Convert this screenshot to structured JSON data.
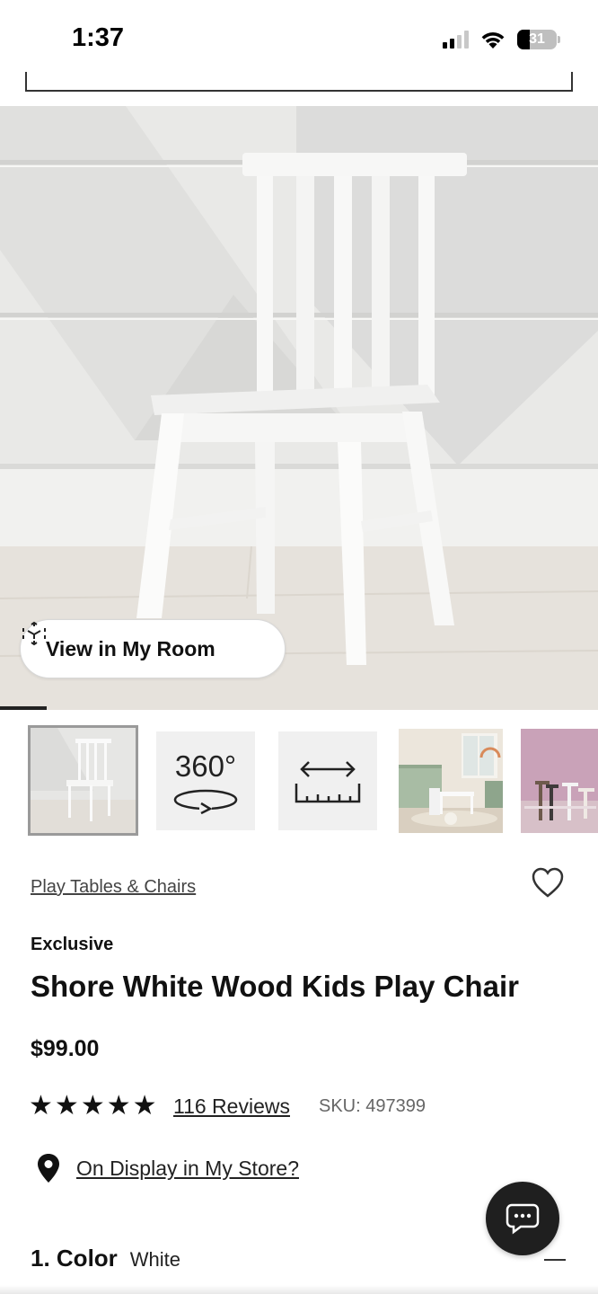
{
  "status_bar": {
    "time": "1:37",
    "battery": "31"
  },
  "gallery": {
    "view_in_room_label": "View in My Room",
    "thumbnails": [
      {
        "name": "chair-photo"
      },
      {
        "name": "360-view",
        "label": "360°"
      },
      {
        "name": "dimensions"
      },
      {
        "name": "room-scene-green"
      },
      {
        "name": "room-scene-pink"
      }
    ]
  },
  "product": {
    "category": "Play Tables & Chairs",
    "badge": "Exclusive",
    "title": "Shore White Wood Kids Play Chair",
    "price": "$99.00",
    "rating": 5,
    "reviews_label": "116 Reviews",
    "sku": "SKU: 497399",
    "display_link": "On Display in My Store?"
  },
  "options": {
    "color_heading": "1. Color",
    "color_value": "White"
  },
  "colors": {
    "accent": "#111111",
    "chat_button": "#1f1f1f",
    "hero_bg": "#ececea"
  },
  "icons": {
    "status": [
      "signal-icon",
      "wifi-icon",
      "battery-icon"
    ],
    "ar": "ar-cube-icon",
    "favorite": "heart-icon",
    "location": "map-pin-icon",
    "chat": "chat-icon",
    "collapse": "minus-icon"
  }
}
